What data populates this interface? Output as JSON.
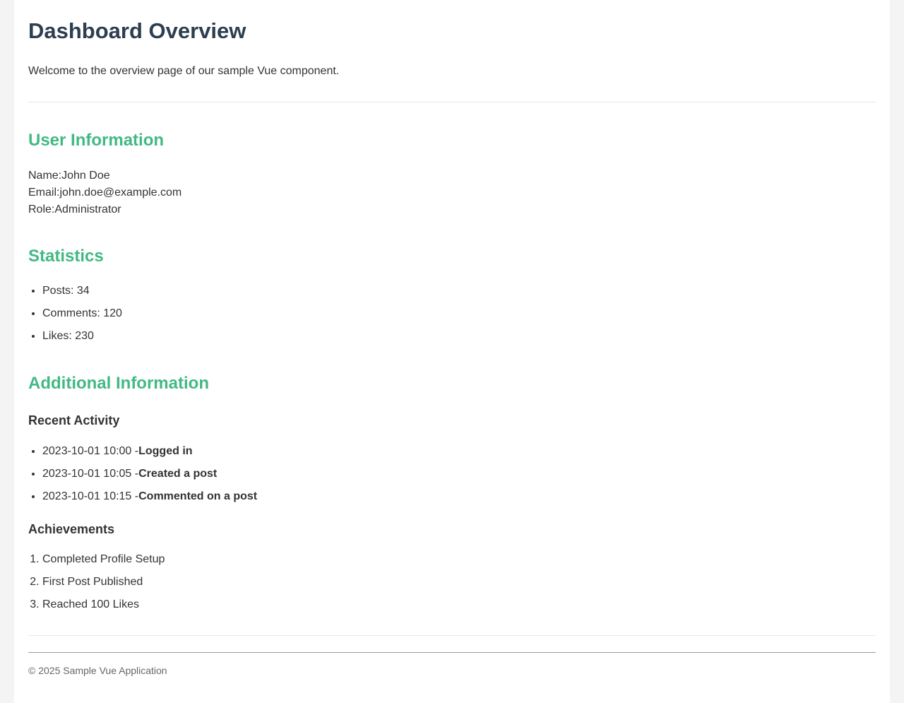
{
  "header": {
    "title": "Dashboard Overview",
    "intro": "Welcome to the overview page of our sample Vue component."
  },
  "user_info": {
    "title": "User Information",
    "name_label": "Name:",
    "name": "John Doe",
    "email_label": "Email:",
    "email": "john.doe@example.com",
    "role_label": "Role:",
    "role": "Administrator"
  },
  "statistics": {
    "title": "Statistics",
    "items": [
      {
        "text": "Posts: 34"
      },
      {
        "text": "Comments: 120"
      },
      {
        "text": "Likes: 230"
      }
    ]
  },
  "additional": {
    "title": "Additional Information",
    "recent_activity": {
      "title": "Recent Activity",
      "items": [
        {
          "time": "2023-10-01 10:00 -",
          "action": "Logged in"
        },
        {
          "time": "2023-10-01 10:05 -",
          "action": "Created a post"
        },
        {
          "time": "2023-10-01 10:15 -",
          "action": "Commented on a post"
        }
      ]
    },
    "achievements": {
      "title": "Achievements",
      "items": [
        {
          "text": "Completed Profile Setup"
        },
        {
          "text": "First Post Published"
        },
        {
          "text": "Reached 100 Likes"
        }
      ]
    }
  },
  "footer": {
    "text": "© 2025 Sample Vue Application"
  },
  "colors": {
    "page_background": "#f4f4f4",
    "card_background": "#ffffff",
    "title": "#2c3e50",
    "section_accent": "#42b983",
    "body_text": "#333333",
    "footer_text": "#666666"
  }
}
